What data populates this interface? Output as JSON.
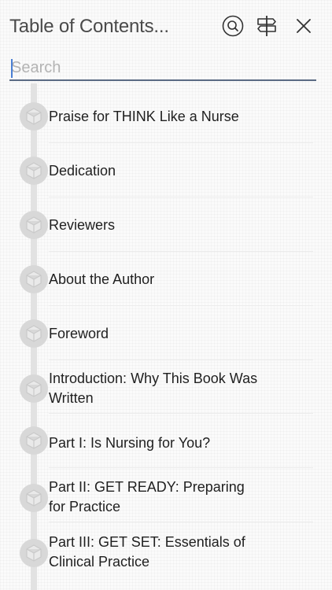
{
  "header": {
    "title": "Table of Contents...",
    "search_icon": "search-icon",
    "signpost_icon": "signpost-icon",
    "close_icon": "close-icon"
  },
  "search": {
    "placeholder": "Search",
    "value": ""
  },
  "toc": {
    "items": [
      {
        "label": "Praise for THINK Like a Nurse",
        "icon": "cube-icon"
      },
      {
        "label": "Dedication",
        "icon": "cube-icon"
      },
      {
        "label": "Reviewers",
        "icon": "cube-icon"
      },
      {
        "label": "About the Author",
        "icon": "cube-icon"
      },
      {
        "label": "Foreword",
        "icon": "cube-icon"
      },
      {
        "label": "Introduction: Why This Book Was Written",
        "icon": "cube-icon"
      },
      {
        "label": "Part I: Is Nursing for You?",
        "icon": "cube-icon"
      },
      {
        "label": "Part II: GET READY: Preparing for Practice",
        "icon": "cube-icon"
      },
      {
        "label": "Part III: GET SET: Essentials of Clinical Practice",
        "icon": "cube-icon"
      }
    ]
  },
  "colors": {
    "accent_underline": "#5b6b84",
    "cursor": "#4a7fd4",
    "timeline": "#e2e2e2"
  }
}
